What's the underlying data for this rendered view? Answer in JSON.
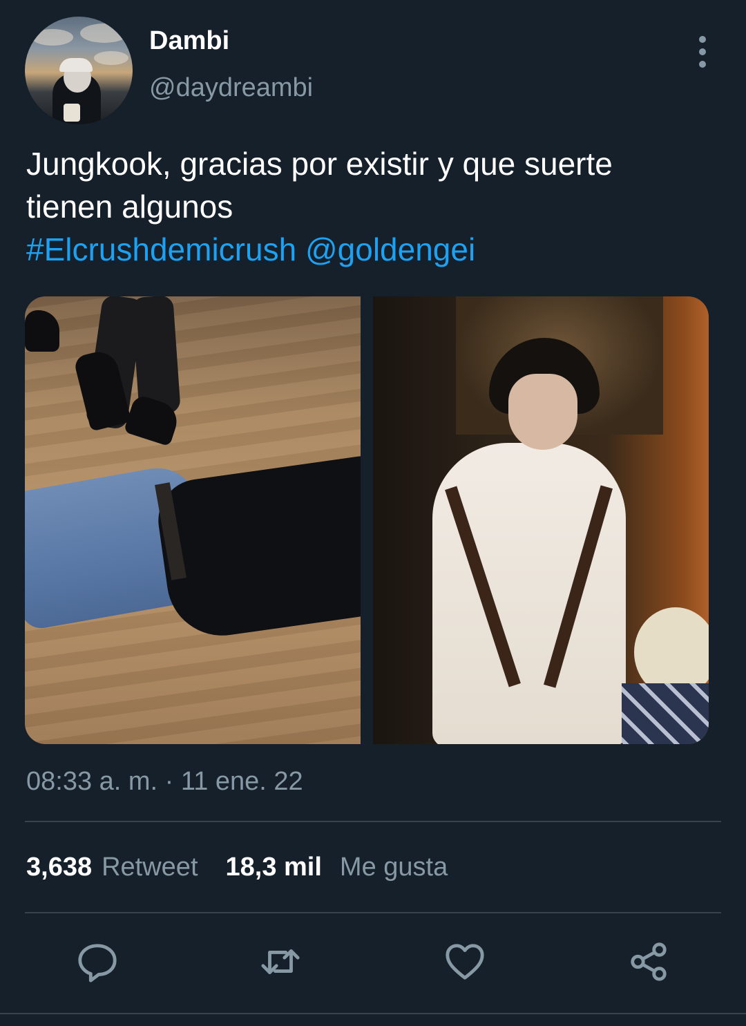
{
  "user": {
    "display_name": "Dambi",
    "handle": "@daydreambi"
  },
  "tweet": {
    "text_line1": "Jungkook, gracias por existir y que suerte",
    "text_line2": "tienen algunos",
    "hashtag": "#Elcrushdemicrush",
    "mention": "@goldengei",
    "timestamp": "08:33 a. m. · 11 ene. 22"
  },
  "stats": {
    "retweets_count": "3,638",
    "retweets_label": "Retweet",
    "likes_count": "18,3 mil",
    "likes_label": "Me gusta"
  },
  "actions": [
    "reply-icon",
    "retweet-icon",
    "like-icon",
    "share-icon"
  ],
  "colors": {
    "background": "#15202b",
    "link": "#1da1f2",
    "secondary_text": "#8899a6",
    "divider": "#38444d"
  }
}
